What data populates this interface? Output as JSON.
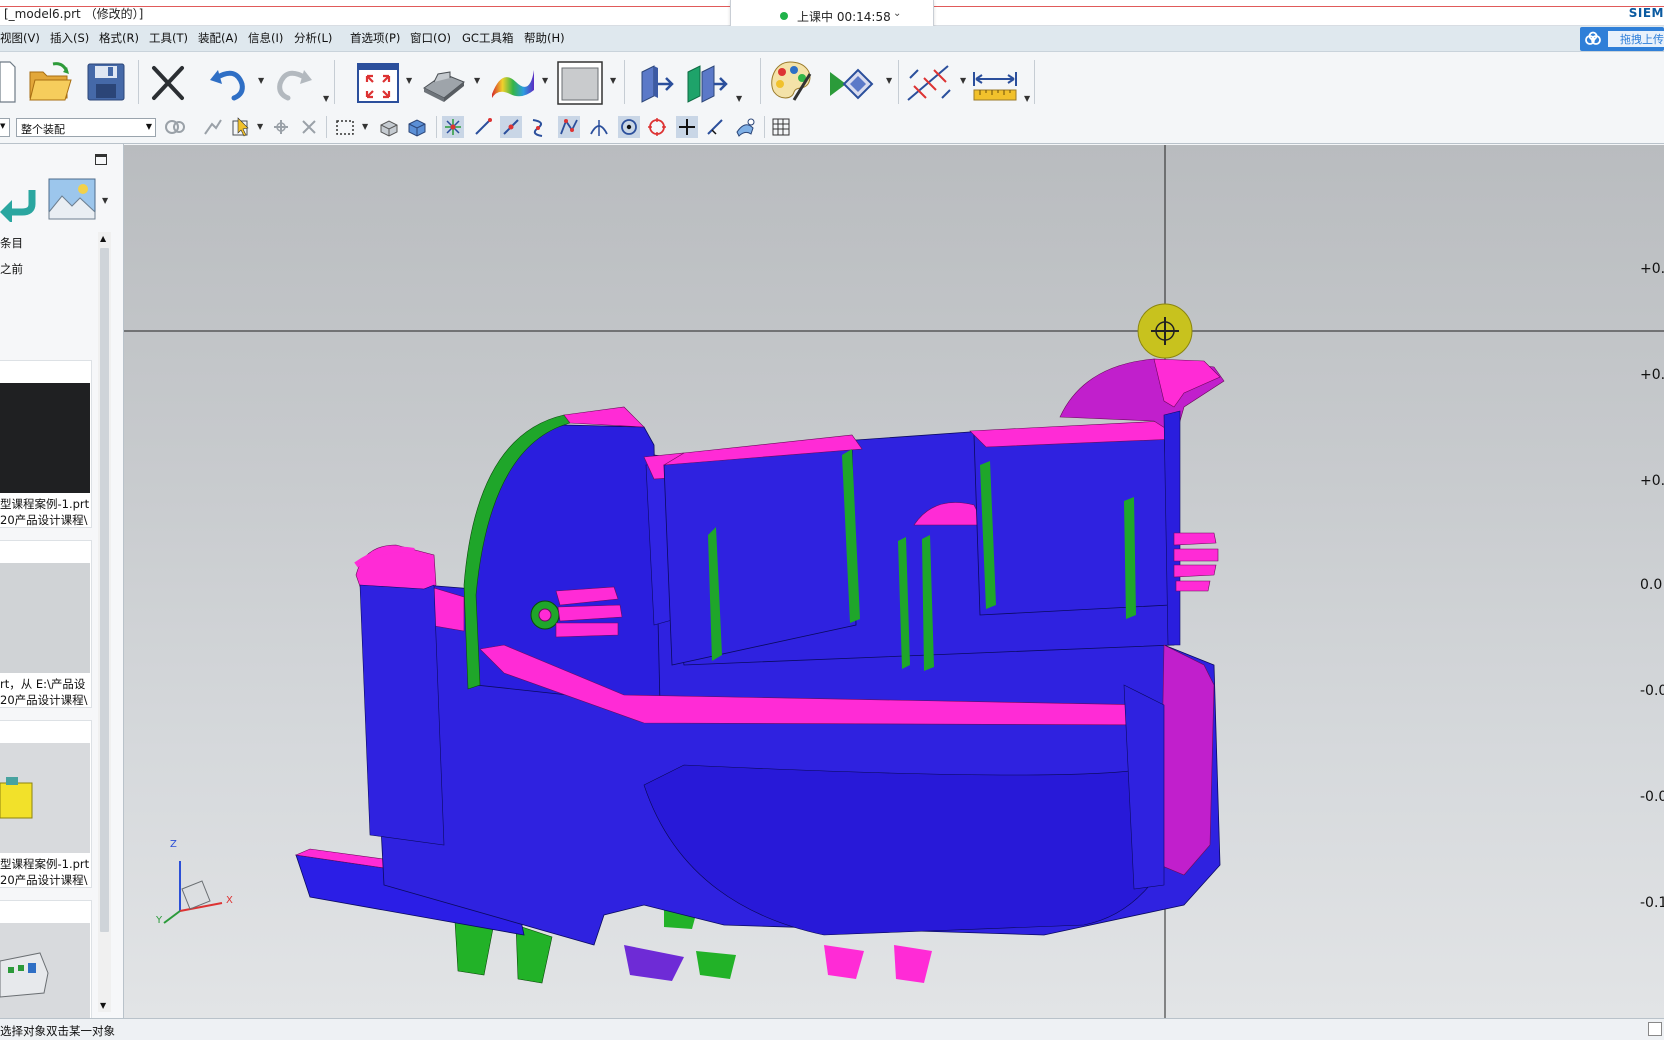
{
  "window": {
    "title": "[_model6.prt （修改的）]",
    "brand": "SIEM"
  },
  "recording": {
    "status": "上课中 00:14:58"
  },
  "menu": {
    "items": [
      "视图(V)",
      "插入(S)",
      "格式(R)",
      "工具(T)",
      "装配(A)",
      "信息(I)",
      "分析(L)",
      "首选项(P)",
      "窗口(O)",
      "GC工具箱",
      "帮助(H)"
    ]
  },
  "cloud": {
    "label": "拖拽上传"
  },
  "toolbar2": {
    "assembly_scope": "整个装配"
  },
  "history_panel": {
    "line1": "条目",
    "line2": "之前",
    "cards": [
      {
        "l1": "型课程案例-1.prt",
        "l2": "20产品设计课程\\"
      },
      {
        "l1": "rt，从 E:\\产品设",
        "l2": "20产品设计课程\\"
      },
      {
        "l1": "型课程案例-1.prt",
        "l2": "20产品设计课程\\"
      }
    ]
  },
  "viewport": {
    "y_labels": [
      "+0.",
      "+0.",
      "+0.",
      "0.0",
      "-0.0",
      "-0.0",
      "-0.1"
    ],
    "triad": {
      "x": "X",
      "y": "Y",
      "z": "Z"
    }
  },
  "status": {
    "message": "选择对象双击某一对象"
  }
}
